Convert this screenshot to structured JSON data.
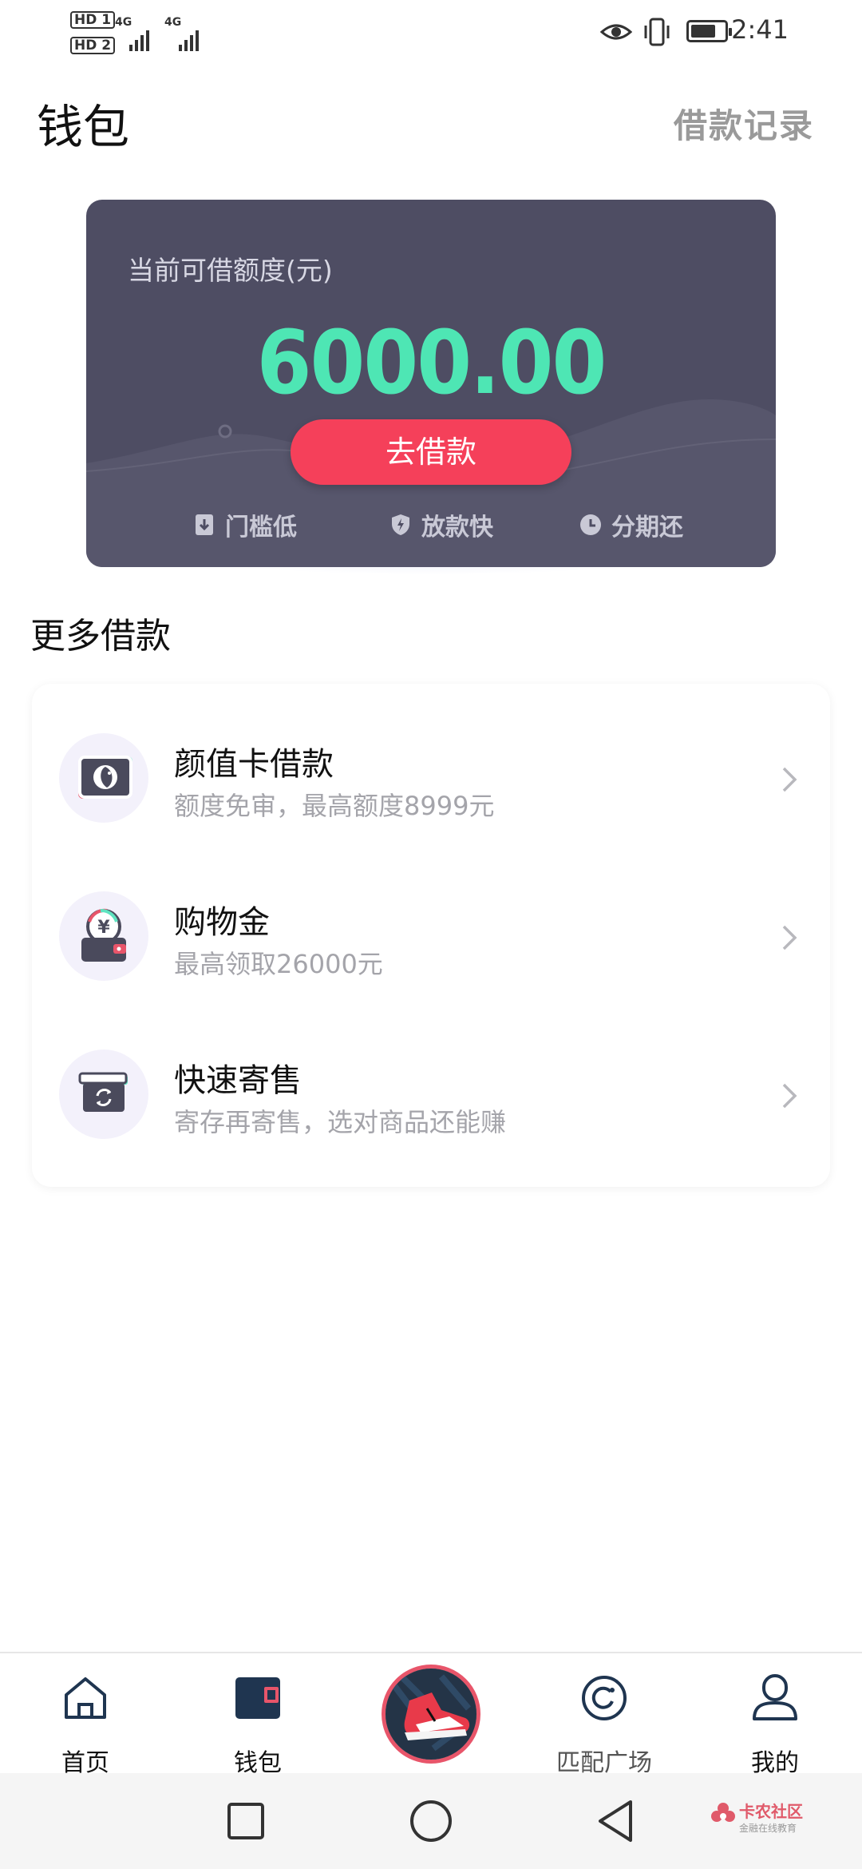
{
  "status_bar": {
    "sim1": "HD 1",
    "sim2": "HD 2",
    "net1": "4G",
    "net2": "4G",
    "time": "2:41",
    "battery_level": 0.75
  },
  "header": {
    "title": "钱包",
    "records_link": "借款记录"
  },
  "credit_card": {
    "label": "当前可借额度(元)",
    "amount": "6000.00",
    "borrow_button": "去借款",
    "features": [
      "门槛低",
      "放款快",
      "分期还"
    ],
    "accent_color": "#4ee6b4",
    "button_color": "#f5405a"
  },
  "more_loans": {
    "title": "更多借款",
    "items": [
      {
        "title": "颜值卡借款",
        "desc": "额度免审，最高额度8999元",
        "icon": "face-card-icon"
      },
      {
        "title": "购物金",
        "desc": "最高领取26000元",
        "icon": "shopping-wallet-icon"
      },
      {
        "title": "快速寄售",
        "desc": "寄存再寄售，选对商品还能赚",
        "icon": "consign-box-icon"
      }
    ]
  },
  "tab_bar": {
    "tabs": [
      {
        "label": "首页",
        "icon": "home-icon"
      },
      {
        "label": "钱包",
        "icon": "wallet-icon"
      },
      {
        "label": "",
        "icon": "sneaker-icon"
      },
      {
        "label": "匹配广场",
        "icon": "match-icon"
      },
      {
        "label": "我的",
        "icon": "profile-icon"
      }
    ]
  },
  "watermark": {
    "name": "卡农社区",
    "sub": "金融在线教育"
  }
}
